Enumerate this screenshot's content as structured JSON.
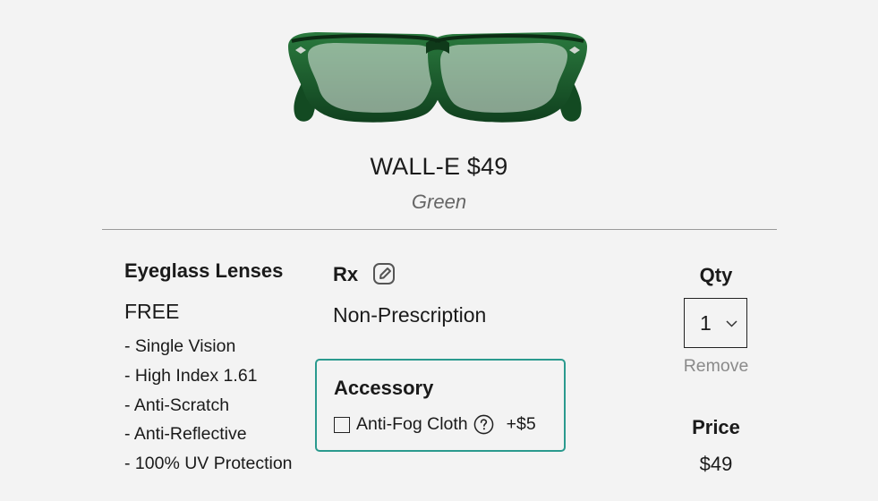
{
  "product": {
    "name_price": "WALL-E $49",
    "color": "Green",
    "image_icon": "green-eyeglasses-frame",
    "frame_color": "#1e5a2c"
  },
  "lenses": {
    "title": "Eyeglass Lenses",
    "price": "FREE",
    "features": [
      "- Single Vision",
      "- High Index 1.61",
      "- Anti-Scratch",
      "- Anti-Reflective",
      "- 100% UV Protection"
    ]
  },
  "rx": {
    "title": "Rx",
    "edit_icon": "edit-pencil-icon",
    "value": "Non-Prescription"
  },
  "accessory": {
    "title": "Accessory",
    "option_label": "Anti-Fog Cloth",
    "option_checked": false,
    "option_price": "+$5",
    "border_color": "#2a9a8e",
    "help_icon": "question-circle-icon"
  },
  "quantity": {
    "title": "Qty",
    "selected": "1",
    "remove_label": "Remove"
  },
  "price": {
    "title": "Price",
    "value": "$49"
  },
  "colors": {
    "background": "#f3f3f3",
    "text": "#1a1a1a",
    "muted": "#8a8a8a",
    "accent": "#2a9a8e"
  }
}
